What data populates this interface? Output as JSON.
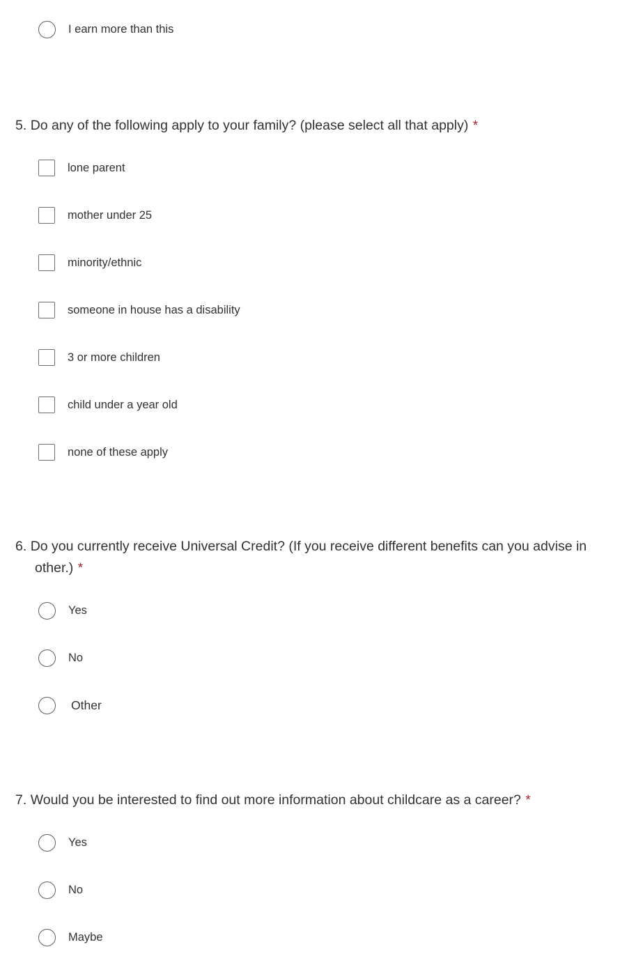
{
  "form": {
    "background_color": "#ffffff",
    "text_color": "#323130",
    "required_marker_color": "#a4262c",
    "control_border_color": "#605e5c"
  },
  "carryover_option": {
    "type": "radio",
    "label": "I earn more than this"
  },
  "questions": [
    {
      "number": "5.",
      "text": "Do any of the following apply to your family? (please select all that apply)",
      "required": true,
      "required_marker": "*",
      "input_type": "checkbox",
      "options": [
        {
          "label": "lone parent",
          "indented": false
        },
        {
          "label": "mother under 25",
          "indented": false
        },
        {
          "label": "minority/ethnic",
          "indented": false
        },
        {
          "label": "someone in house has a disability",
          "indented": false
        },
        {
          "label": "3 or more children",
          "indented": false
        },
        {
          "label": "child under a year old",
          "indented": false
        },
        {
          "label": "none of these apply",
          "indented": false
        }
      ]
    },
    {
      "number": "6.",
      "text": "Do you currently receive Universal Credit? (If you receive different benefits can you advise in other.)",
      "required": true,
      "required_marker": "*",
      "input_type": "radio",
      "options": [
        {
          "label": "Yes",
          "indented": false
        },
        {
          "label": "No",
          "indented": false
        },
        {
          "label": "Other",
          "indented": true
        }
      ]
    },
    {
      "number": "7.",
      "text": "Would you be interested to find out more information about childcare as a career?",
      "required": true,
      "required_marker": "*",
      "input_type": "radio",
      "options": [
        {
          "label": "Yes",
          "indented": false
        },
        {
          "label": "No",
          "indented": false
        },
        {
          "label": "Maybe",
          "indented": false
        }
      ]
    }
  ]
}
